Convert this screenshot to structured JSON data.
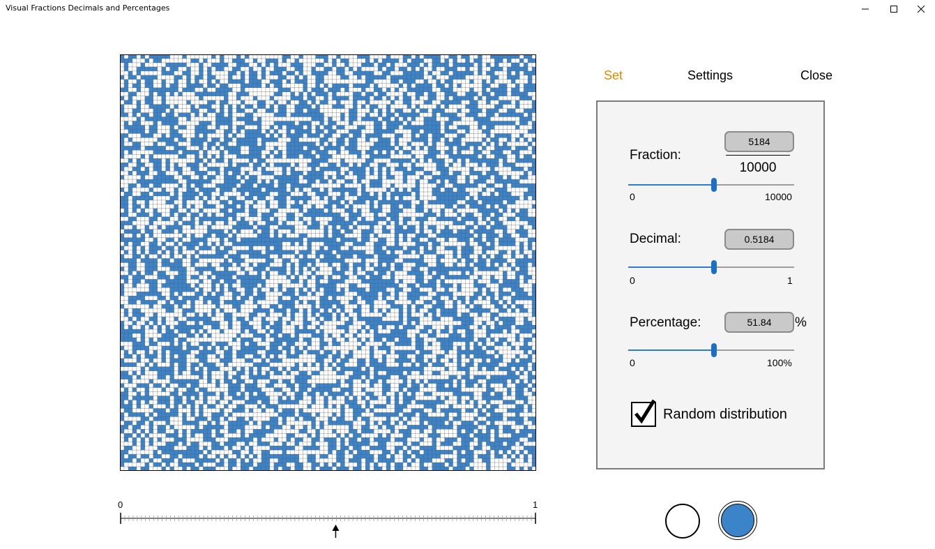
{
  "window": {
    "title": "Visual Fractions Decimals and Percentages",
    "minimize_icon": "minimize-icon",
    "maximize_icon": "maximize-icon",
    "close_icon": "close-icon"
  },
  "grid": {
    "rows": 100,
    "cols": 100,
    "filled_count": 5184,
    "filled_color": "#3b84c9",
    "empty_color": "#ffffff",
    "line_color": "#5a5a5a"
  },
  "ruler": {
    "start_label": "0",
    "end_label": "1",
    "marker_value": 0.5184,
    "marker_icon": "up-arrow-icon"
  },
  "nav": {
    "set": "Set",
    "settings": "Settings",
    "close": "Close"
  },
  "panel": {
    "fraction_label": "Fraction:",
    "numerator": "5184",
    "denominator": "10000",
    "fraction_min": "0",
    "fraction_max": "10000",
    "fraction_value": 0.5184,
    "decimal_label": "Decimal:",
    "decimal_value_text": "0.5184",
    "decimal_min": "0",
    "decimal_max": "1",
    "decimal_value": 0.5184,
    "percentage_label": "Percentage:",
    "percentage_value_text": "51.84",
    "percent_sign": "%",
    "percentage_min": "0",
    "percentage_max": "100%",
    "percentage_value": 0.5184,
    "random_label": "Random distribution",
    "random_checked": true,
    "check_icon": "checkmark-icon"
  },
  "colors": {
    "accent": "#e08a00",
    "slider_fill": "#2b7bd1",
    "slider_track": "#9d9d9d",
    "blue_fill": "#3b84c9"
  },
  "swatches": {
    "white_icon": "white-circle-icon",
    "blue_icon": "blue-circle-icon",
    "selected": "blue"
  }
}
